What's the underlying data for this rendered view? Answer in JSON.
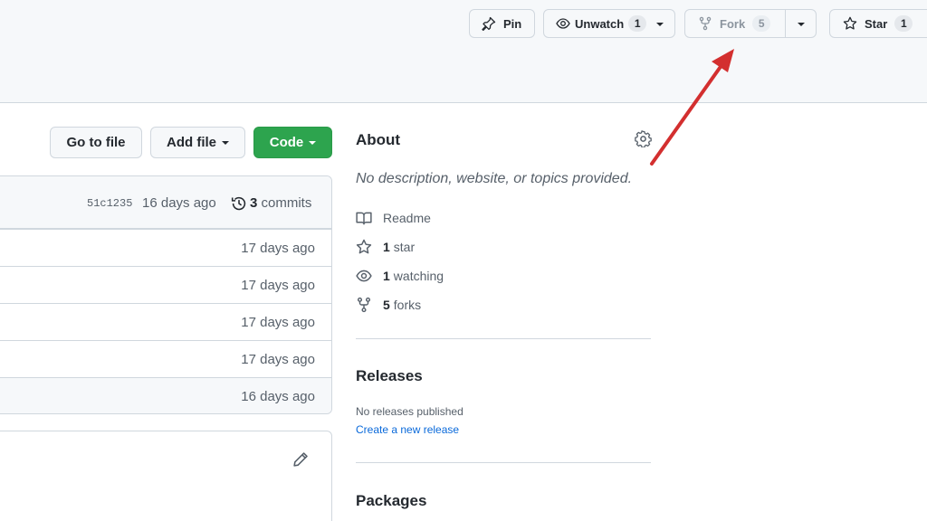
{
  "header": {
    "pin": {
      "label": "Pin",
      "icon": "pin-icon"
    },
    "unwatch": {
      "label": "Unwatch",
      "count": "1",
      "icon": "eye-icon"
    },
    "fork": {
      "label": "Fork",
      "count": "5",
      "icon": "repo-forked-icon"
    },
    "star": {
      "label": "Star",
      "count": "1",
      "icon": "star-icon"
    }
  },
  "toolbar": {
    "go_to_file": "Go to file",
    "add_file": "Add file",
    "code": "Code"
  },
  "latest_commit": {
    "sha": "51c1235",
    "age": "16 days ago",
    "commits_count": "3",
    "commits_label": "commits"
  },
  "files": [
    {
      "age": "17 days ago"
    },
    {
      "age": "17 days ago"
    },
    {
      "age": "17 days ago"
    },
    {
      "age": "17 days ago"
    },
    {
      "age": "16 days ago"
    }
  ],
  "about": {
    "title": "About",
    "description": "No description, website, or topics provided.",
    "readme": "Readme",
    "stars_count": "1",
    "stars_label": "star",
    "watching_count": "1",
    "watching_label": "watching",
    "forks_count": "5",
    "forks_label": "forks"
  },
  "releases": {
    "title": "Releases",
    "empty_text": "No releases published",
    "create_link": "Create a new release"
  },
  "packages": {
    "title": "Packages"
  },
  "colors": {
    "code_button": "#2da44e",
    "link": "#0969da",
    "annotation_arrow": "#d32f2f"
  }
}
